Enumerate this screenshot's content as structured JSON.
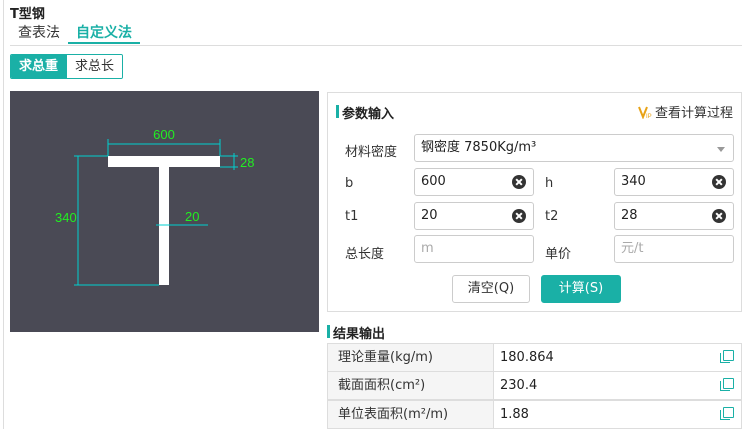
{
  "app": {
    "title": "T型钢"
  },
  "tabs": [
    {
      "label": "查表法",
      "active": false
    },
    {
      "label": "自定义法",
      "active": true
    }
  ],
  "mode": {
    "total_weight_label": "求总重",
    "total_length_label": "求总长"
  },
  "diagram": {
    "width_label": "600",
    "height_label": "340",
    "t1_label": "20",
    "t2_label": "28",
    "line_color": "#00e0e0",
    "text_color": "#22ee22"
  },
  "params": {
    "heading": "参数输入",
    "view_process_label": "查看计算过程",
    "density_label": "材料密度",
    "density_value": "钢密度 7850Kg/m³",
    "b_label": "b",
    "b_value": "600",
    "h_label": "h",
    "h_value": "340",
    "t1_label": "t1",
    "t1_value": "20",
    "t2_label": "t2",
    "t2_value": "28",
    "length_label": "总长度",
    "length_placeholder": "m",
    "price_label": "单价",
    "price_placeholder": "元/t",
    "clear_button": "清空(Q)",
    "calc_button": "计算(S)"
  },
  "results": {
    "heading": "结果输出",
    "rows": [
      {
        "name": "理论重量(kg/m)",
        "value": "180.864"
      },
      {
        "name": "截面面积(cm²)",
        "value": "230.4"
      },
      {
        "name": "单位表面积(m²/m)",
        "value": "1.88"
      }
    ]
  },
  "colors": {
    "accent": "#1ab0a6",
    "canvas_bg": "#4a4a55"
  }
}
